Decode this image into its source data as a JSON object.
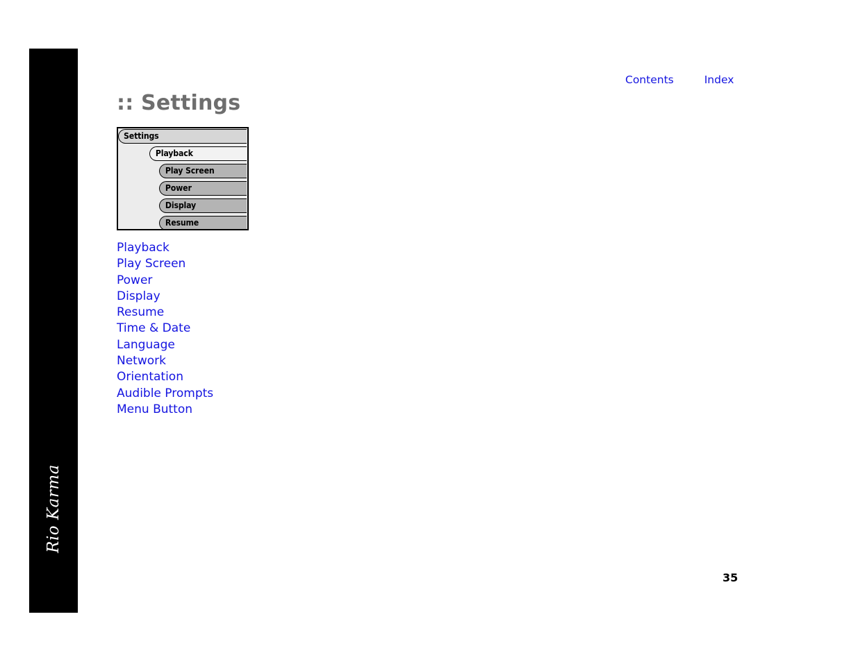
{
  "document": {
    "brand": "Rio Karma",
    "page_number": "35",
    "title": ":: Settings"
  },
  "topnav": {
    "contents_label": "Contents",
    "index_label": "Index"
  },
  "device_screen": {
    "titlebar": "Settings",
    "items": [
      {
        "label": "Playback",
        "selected": true
      },
      {
        "label": "Play Screen",
        "selected": false
      },
      {
        "label": "Power",
        "selected": false
      },
      {
        "label": "Display",
        "selected": false
      },
      {
        "label": "Resume",
        "selected": false
      }
    ]
  },
  "links": [
    "Playback",
    "Play Screen",
    "Power",
    "Display",
    "Resume",
    "Time & Date",
    "Language",
    "Network",
    "Orientation",
    "Audible Prompts",
    "Menu Button"
  ],
  "colors": {
    "link": "#1414e0",
    "title": "#6e6e6e",
    "spine": "#000000",
    "screen_bg": "#ececec",
    "pill_selected": "#f2f2f2",
    "pill_normal": "#b4b4b4",
    "pill_title": "#d6d6d6"
  }
}
